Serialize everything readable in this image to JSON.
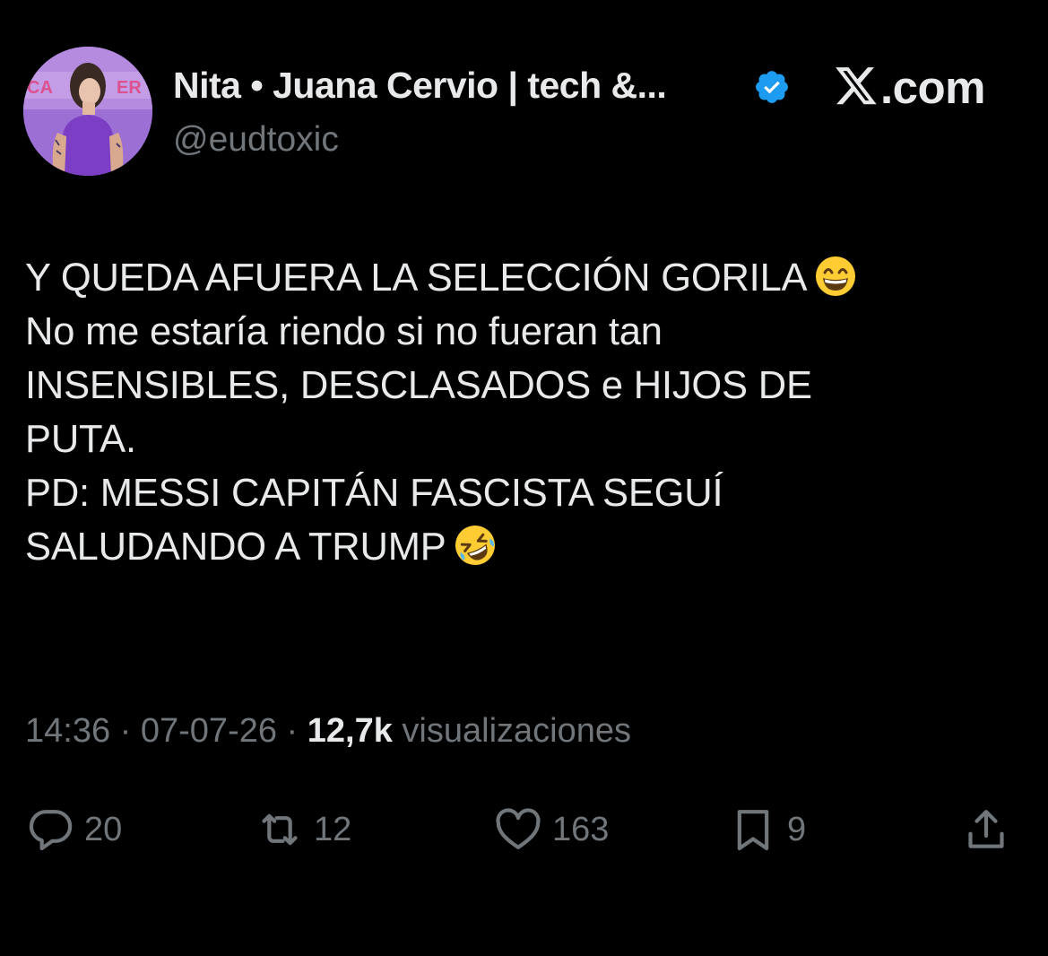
{
  "author": {
    "display_name": "Nita • Juana Cervio | tech &...",
    "handle": "@eudtoxic",
    "verified": true,
    "avatar_sign_text": "CANCER"
  },
  "brand": {
    "logo_icon": "x-logo-icon",
    "suffix": ".com"
  },
  "tweet": {
    "lines": [
      "Y QUEDA AFUERA LA SELECCIÓN GORILA",
      "No me estaría riendo si no fueran tan",
      "INSENSIBLES, DESCLASADOS e HIJOS DE",
      "PUTA.",
      "PD: MESSI CAPITÁN FASCISTA SEGUÍ",
      "SALUDANDO A TRUMP"
    ],
    "emoji_line1": "grinning-face-with-smiling-eyes",
    "emoji_line6": "rolling-on-the-floor-laughing"
  },
  "meta": {
    "time": "14:36",
    "sep1": " · ",
    "date": "07-07-26",
    "sep2": " · ",
    "views_count": "12,7k",
    "views_label": " visualizaciones"
  },
  "actions": {
    "replies": "20",
    "reposts": "12",
    "likes": "163",
    "bookmarks": "9"
  },
  "colors": {
    "background": "#000000",
    "text_primary": "#e7e9ea",
    "text_secondary": "#71767b",
    "verified_blue": "#1d9bf0"
  }
}
